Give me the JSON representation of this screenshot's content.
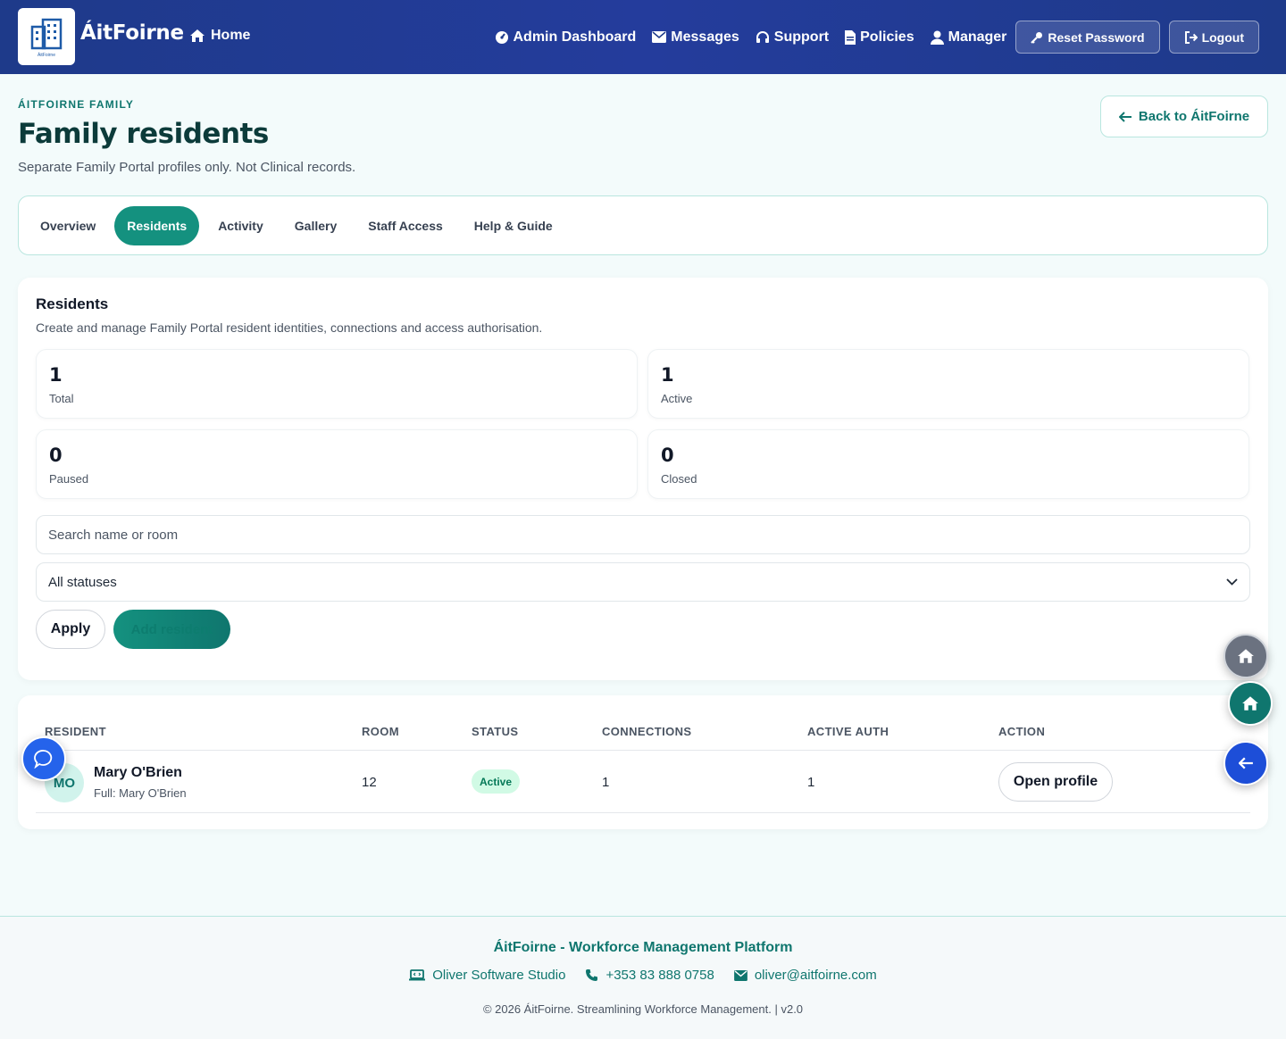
{
  "navbar": {
    "brand": "ÁitFoirne",
    "logo_caption": "ÁitFoirne",
    "home": "Home",
    "links": {
      "admin_dashboard": "Admin Dashboard",
      "messages": "Messages",
      "support": "Support",
      "policies": "Policies",
      "manager": "Manager"
    },
    "reset_password": "Reset Password",
    "logout": "Logout"
  },
  "header": {
    "eyebrow": "ÁITFOIRNE FAMILY",
    "title": "Family residents",
    "subtitle": "Separate Family Portal profiles only. Not Clinical records.",
    "back_button": "Back to ÁitFoirne"
  },
  "tabs": [
    {
      "label": "Overview",
      "active": false
    },
    {
      "label": "Residents",
      "active": true
    },
    {
      "label": "Activity",
      "active": false
    },
    {
      "label": "Gallery",
      "active": false
    },
    {
      "label": "Staff Access",
      "active": false
    },
    {
      "label": "Help & Guide",
      "active": false
    }
  ],
  "residents_card": {
    "title": "Residents",
    "subtitle": "Create and manage Family Portal resident identities, connections and access authorisation.",
    "stats": [
      {
        "value": "1",
        "label": "Total"
      },
      {
        "value": "1",
        "label": "Active"
      },
      {
        "value": "0",
        "label": "Paused"
      },
      {
        "value": "0",
        "label": "Closed"
      }
    ],
    "search_placeholder": "Search name or room",
    "status_selected": "All statuses",
    "apply": "Apply",
    "add_resident": "Add resident"
  },
  "table": {
    "headers": {
      "resident": "RESIDENT",
      "room": "ROOM",
      "status": "STATUS",
      "connections": "CONNECTIONS",
      "active_auth": "ACTIVE AUTH",
      "action": "ACTION"
    },
    "rows": [
      {
        "initials": "MO",
        "name": "Mary O'Brien",
        "full": "Full: Mary O'Brien",
        "room": "12",
        "status": "Active",
        "connections": "1",
        "active_auth": "1",
        "action": "Open profile"
      }
    ]
  },
  "footer": {
    "title": "ÁitFoirne - Workforce Management Platform",
    "company": "Oliver Software Studio",
    "phone": "+353 83 888 0758",
    "email": "oliver@aitfoirne.com",
    "copyright": "© 2026 ÁitFoirne. Streamlining Workforce Management. | v2.0"
  },
  "colors": {
    "navbar": "#1e3a8a",
    "accent": "#14917f",
    "title": "#0c3b3a",
    "active_badge": "#d1fae5"
  }
}
